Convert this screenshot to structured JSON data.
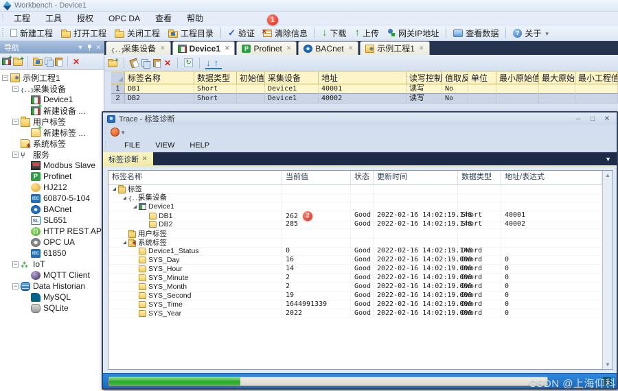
{
  "colors": {
    "accent_red": "#e0281c",
    "tabstrip_navy": "#26334e",
    "dialog_tabstrip_navy": "#1d2b48",
    "progress_green": "#2aa82a",
    "status_strip_blue": "#1f7ad2",
    "grid_header_yellow": "#fdf5c9",
    "grid_row_blue": "#ccd5e6"
  },
  "titlebar": {
    "title": "Workbench - Device1"
  },
  "menubar": {
    "items": [
      "工程",
      "工具",
      "授权",
      "OPC DA",
      "查看",
      "帮助"
    ]
  },
  "toolbar": {
    "new": "新建工程",
    "open": "打开工程",
    "close": "关闭工程",
    "dir": "工程目录",
    "verify": "验证",
    "clear": "清除信息",
    "download": "下载",
    "upload": "上传",
    "gateway": "网关IP地址",
    "viewdata": "查看数据",
    "about": "关于",
    "download_badge": "1"
  },
  "nav": {
    "title": "导航",
    "items": [
      {
        "label": "示例工程1"
      },
      {
        "label": "采集设备"
      },
      {
        "label": "Device1"
      },
      {
        "label": "新建设备 ..."
      },
      {
        "label": "用户标签"
      },
      {
        "label": "新建标签 ..."
      },
      {
        "label": "系统标签"
      },
      {
        "label": "服务"
      },
      {
        "label": "Modbus Slave"
      },
      {
        "label": "Profinet"
      },
      {
        "label": "HJ212"
      },
      {
        "label": "60870-5-104"
      },
      {
        "label": "BACnet"
      },
      {
        "label": "SL651"
      },
      {
        "label": "HTTP REST API"
      },
      {
        "label": "OPC UA"
      },
      {
        "label": "61850"
      },
      {
        "label": "IoT"
      },
      {
        "label": "MQTT Client"
      },
      {
        "label": "Data Historian"
      },
      {
        "label": "MySQL"
      },
      {
        "label": "SQLite"
      }
    ]
  },
  "tabs": {
    "items": [
      {
        "label": "采集设备"
      },
      {
        "label": "Device1"
      },
      {
        "label": "Profinet"
      },
      {
        "label": "BACnet"
      },
      {
        "label": "示例工程1"
      }
    ]
  },
  "grid": {
    "headers": [
      "标签名称",
      "数据类型",
      "初始值",
      "采集设备",
      "地址",
      "读写控制",
      "值取反",
      "单位",
      "最小原始值",
      "最大原始值",
      "最小工程值"
    ],
    "rows": [
      {
        "num": "1",
        "cells": [
          "DB1",
          "Short",
          "",
          "Device1",
          "40001",
          "读写",
          "No",
          "",
          "",
          "",
          ""
        ]
      },
      {
        "num": "2",
        "cells": [
          "DB2",
          "Short",
          "",
          "Device1",
          "40002",
          "读写",
          "No",
          "",
          "",
          "",
          ""
        ]
      }
    ]
  },
  "dialog": {
    "title": "Trace - 标签诊断",
    "window_buttons": {
      "minimize": "–",
      "maximize": "□",
      "close": "✕"
    },
    "menu": [
      "FILE",
      "VIEW",
      "HELP"
    ],
    "tab": "标签诊断",
    "table": {
      "headers": [
        "标签名称",
        "当前值",
        "状态",
        "更新时间",
        "数据类型",
        "地址/表达式"
      ],
      "rows": [
        {
          "name": "标签",
          "value": "",
          "status": "",
          "time": "",
          "type": "",
          "addr": ""
        },
        {
          "name": "采集设备",
          "value": "",
          "status": "",
          "time": "",
          "type": "",
          "addr": ""
        },
        {
          "name": "Device1",
          "value": "",
          "status": "",
          "time": "",
          "type": "",
          "addr": ""
        },
        {
          "name": "DB1",
          "value": "262",
          "status": "Good",
          "time": "2022-02-16 14:02:19.148",
          "type": "Short",
          "addr": "40001"
        },
        {
          "name": "DB2",
          "value": "285",
          "status": "Good",
          "time": "2022-02-16 14:02:19.148",
          "type": "Short",
          "addr": "40002"
        },
        {
          "name": "用户标签",
          "value": "",
          "status": "",
          "time": "",
          "type": "",
          "addr": ""
        },
        {
          "name": "系统标签",
          "value": "",
          "status": "",
          "time": "",
          "type": "",
          "addr": ""
        },
        {
          "name": "Device1_Status",
          "value": "0",
          "status": "Good",
          "time": "2022-02-16 14:02:19.148",
          "type": "DWord",
          "addr": ""
        },
        {
          "name": "SYS_Day",
          "value": "16",
          "status": "Good",
          "time": "2022-02-16 14:02:19.000",
          "type": "DWord",
          "addr": "0"
        },
        {
          "name": "SYS_Hour",
          "value": "14",
          "status": "Good",
          "time": "2022-02-16 14:02:19.000",
          "type": "DWord",
          "addr": "0"
        },
        {
          "name": "SYS_Minute",
          "value": "2",
          "status": "Good",
          "time": "2022-02-16 14:02:19.000",
          "type": "DWord",
          "addr": "0"
        },
        {
          "name": "SYS_Month",
          "value": "2",
          "status": "Good",
          "time": "2022-02-16 14:02:19.000",
          "type": "DWord",
          "addr": "0"
        },
        {
          "name": "SYS_Second",
          "value": "19",
          "status": "Good",
          "time": "2022-02-16 14:02:19.000",
          "type": "DWord",
          "addr": "0"
        },
        {
          "name": "SYS_Time",
          "value": "1644991339",
          "status": "Good",
          "time": "2022-02-16 14:02:19.000",
          "type": "DWord",
          "addr": "0"
        },
        {
          "name": "SYS_Year",
          "value": "2022",
          "status": "Good",
          "time": "2022-02-16 14:02:19.000",
          "type": "DWord",
          "addr": "0"
        }
      ]
    },
    "status": {
      "progress_pct": 30
    },
    "value_badge": "2"
  },
  "watermark": "CSDN @上海仰科"
}
